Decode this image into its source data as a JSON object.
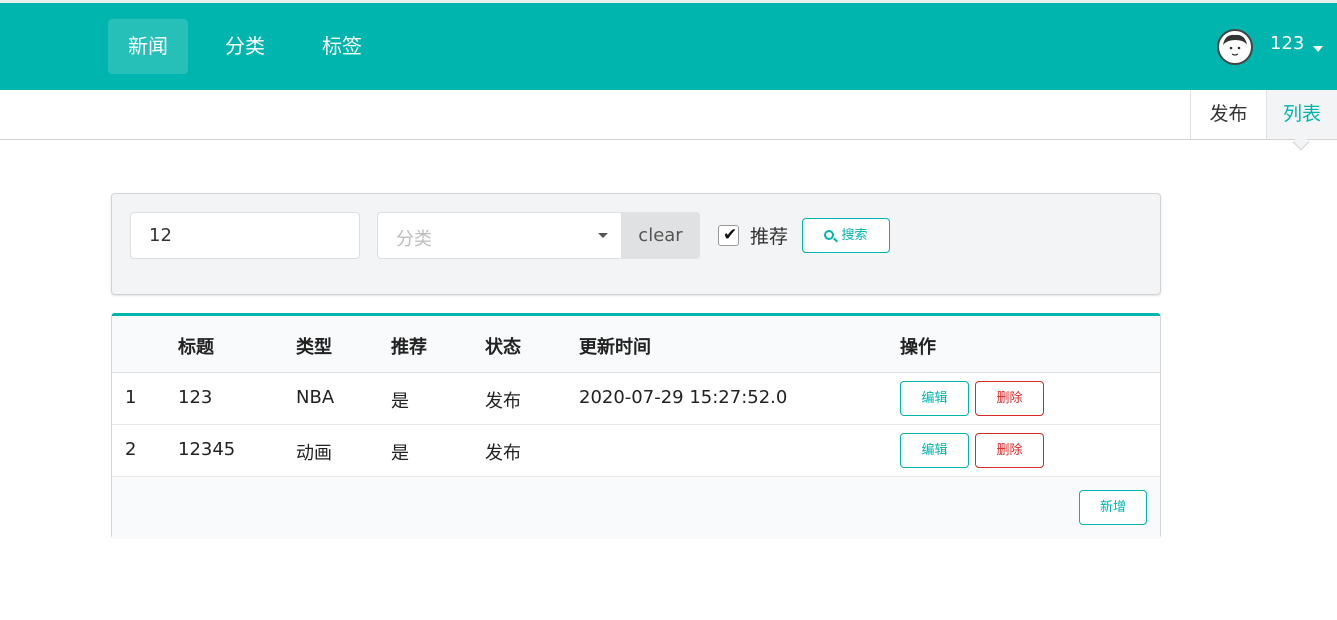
{
  "nav": {
    "items": [
      {
        "label": "新闻",
        "active": true
      },
      {
        "label": "分类",
        "active": false
      },
      {
        "label": "标签",
        "active": false
      }
    ],
    "user": {
      "name": "123"
    }
  },
  "subnav": {
    "tabs": [
      {
        "label": "发布",
        "active": false
      },
      {
        "label": "列表",
        "active": true
      }
    ]
  },
  "search": {
    "title_value": "12",
    "category_placeholder": "分类",
    "clear_label": "clear",
    "recommend_label": "推荐",
    "recommend_checked": true,
    "search_label": "搜索"
  },
  "table": {
    "headers": [
      "",
      "标题",
      "类型",
      "推荐",
      "状态",
      "更新时间",
      "操作"
    ],
    "rows": [
      {
        "index": "1",
        "title": "123",
        "type": "NBA",
        "recommend": "是",
        "status": "发布",
        "updated": "2020-07-29 15:27:52.0"
      },
      {
        "index": "2",
        "title": "12345",
        "type": "动画",
        "recommend": "是",
        "status": "发布",
        "updated": ""
      }
    ],
    "edit_label": "编辑",
    "delete_label": "删除",
    "add_label": "新增"
  },
  "colors": {
    "accent": "#00b5ad",
    "danger": "#db2828"
  }
}
